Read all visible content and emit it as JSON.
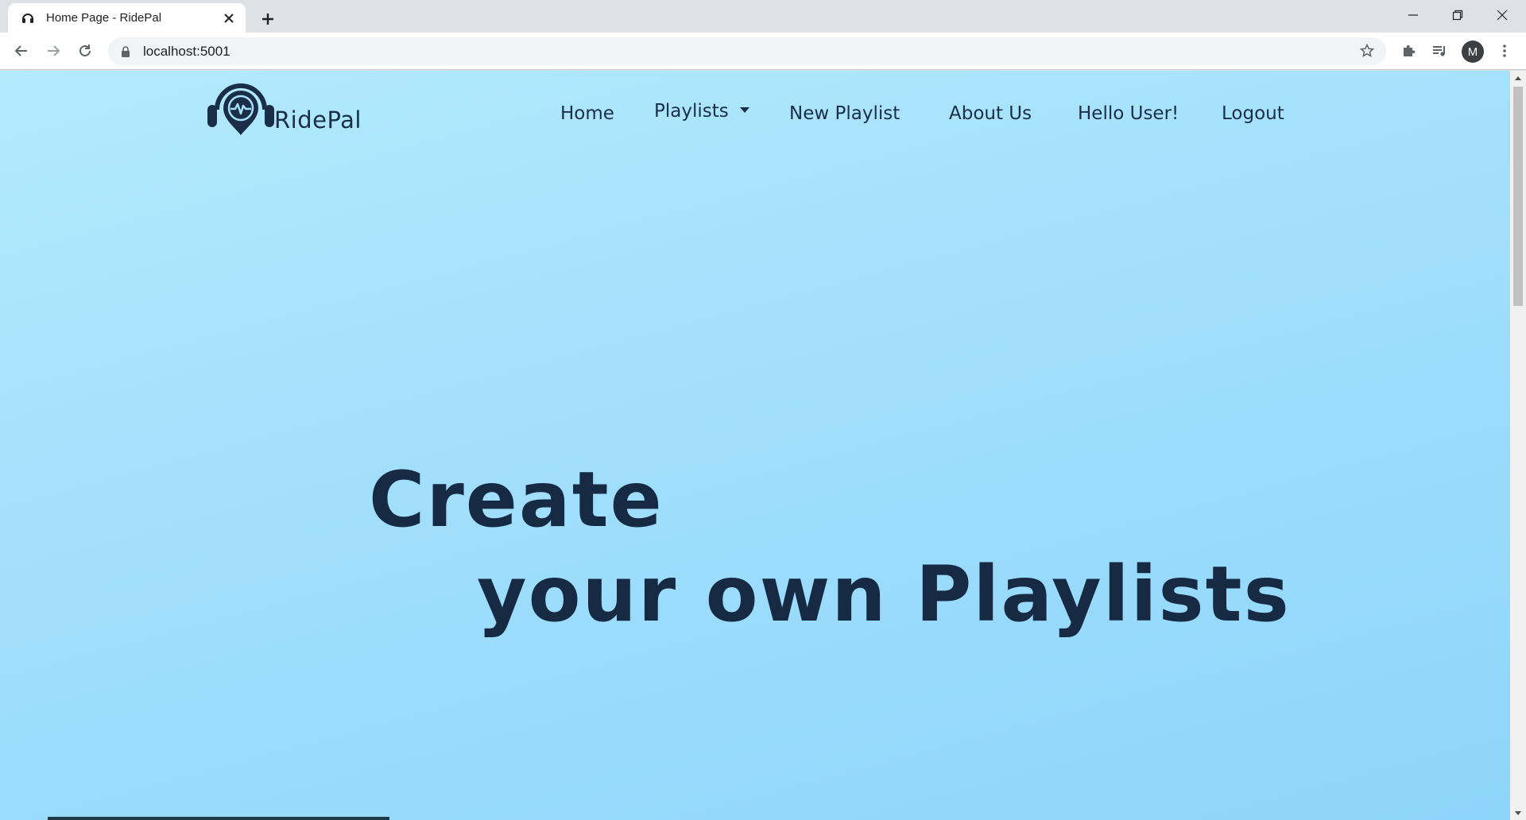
{
  "browser": {
    "tab_title": "Home Page - RidePal",
    "url": "localhost:5001",
    "profile_initial": "M"
  },
  "site": {
    "logo_text": "RidePal",
    "nav": {
      "home": "Home",
      "playlists": "Playlists",
      "new_playlist": "New Playlist",
      "about_us": "About Us",
      "greeting": "Hello User!",
      "logout": "Logout"
    },
    "hero": {
      "line1": "Create",
      "line2": "your own Playlists"
    }
  },
  "colors": {
    "brand_dark": "#1b2e48",
    "background_top": "#b3ebfd",
    "background_bottom": "#8ed5fb"
  }
}
